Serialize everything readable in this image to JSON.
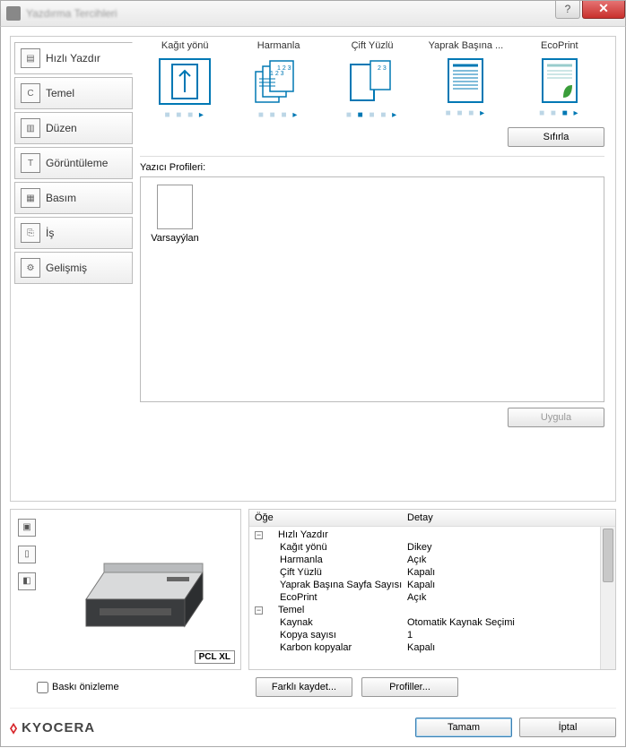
{
  "window": {
    "title": "Yazdırma Tercihleri"
  },
  "tabs": {
    "quick": "Hızlı Yazdır",
    "basic": "Temel",
    "layout": "Düzen",
    "imaging": "Görüntüleme",
    "publishing": "Basım",
    "job": "İş",
    "advanced": "Gelişmiş"
  },
  "options": {
    "orientation": "Kağıt yönü",
    "collate": "Harmanla",
    "duplex": "Çift Yüzlü",
    "pagesPerSheet": "Yaprak Başına ...",
    "ecoprint": "EcoPrint"
  },
  "buttons": {
    "reset": "Sıfırla",
    "apply": "Uygula",
    "saveAs": "Farklı kaydet...",
    "profiles": "Profiller...",
    "ok": "Tamam",
    "cancel": "İptal"
  },
  "profiles": {
    "label": "Yazıcı Profileri:",
    "default": "Varsayýlan"
  },
  "preview": {
    "checkbox": "Baskı önizleme",
    "badge": "PCL XL"
  },
  "details": {
    "col_item": "Öğe",
    "col_detail": "Detay",
    "rows": [
      {
        "type": "group",
        "label": "Hızlı Yazdır"
      },
      {
        "type": "item",
        "label": "Kağıt yönü",
        "value": "Dikey"
      },
      {
        "type": "item",
        "label": "Harmanla",
        "value": "Açık"
      },
      {
        "type": "item",
        "label": "Çift Yüzlü",
        "value": "Kapalı"
      },
      {
        "type": "item",
        "label": "Yaprak Başına Sayfa Sayısı",
        "value": "Kapalı"
      },
      {
        "type": "item",
        "label": "EcoPrint",
        "value": "Açık"
      },
      {
        "type": "group",
        "label": "Temel"
      },
      {
        "type": "item",
        "label": "Kaynak",
        "value": "Otomatik Kaynak Seçimi"
      },
      {
        "type": "item",
        "label": "Kopya sayısı",
        "value": "1"
      },
      {
        "type": "item",
        "label": "Karbon kopyalar",
        "value": "Kapalı"
      }
    ]
  },
  "branding": {
    "name": "KYOCERA"
  }
}
